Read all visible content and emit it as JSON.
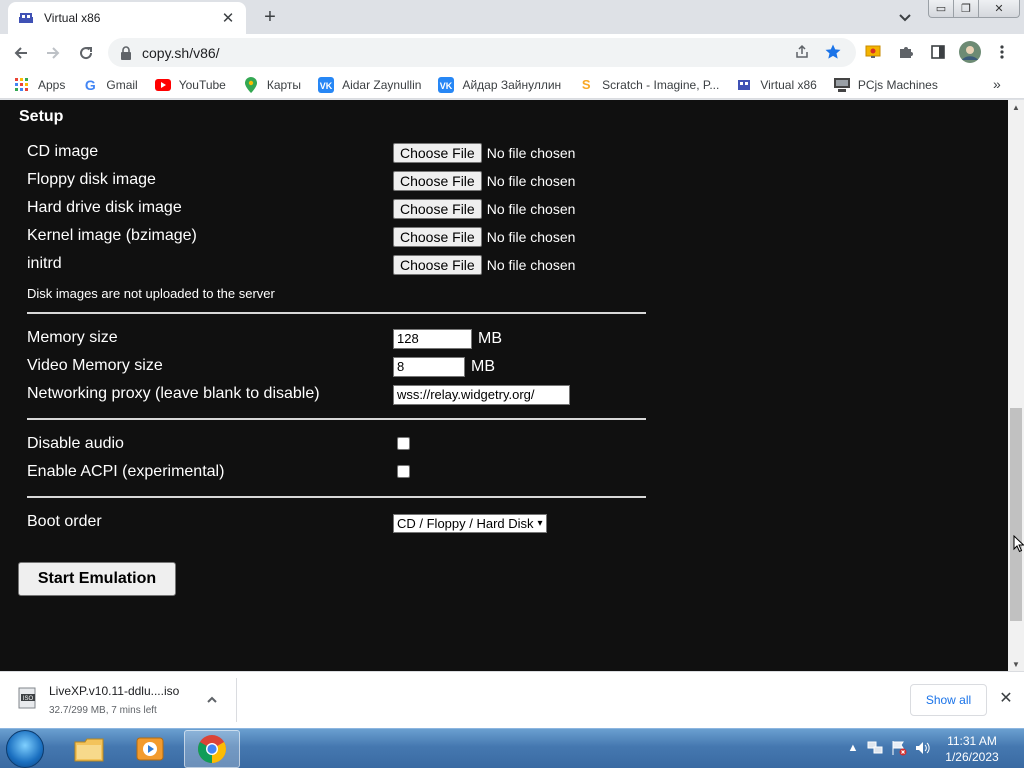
{
  "browser": {
    "tab": {
      "title": "Virtual x86",
      "close": "✕"
    },
    "new_tab": "+",
    "window": {
      "minimize": "▭",
      "maximize": "❐",
      "close": "✕"
    },
    "url": "copy.sh/v86/",
    "bookmarks": [
      {
        "label": "Apps",
        "icon": "apps-grid-icon"
      },
      {
        "label": "Gmail",
        "icon": "google-icon"
      },
      {
        "label": "YouTube",
        "icon": "youtube-icon"
      },
      {
        "label": "Карты",
        "icon": "maps-pin-icon"
      },
      {
        "label": "Aidar Zaynullin",
        "icon": "vk-icon"
      },
      {
        "label": "Айдар Зайнуллин",
        "icon": "vk-icon"
      },
      {
        "label": "Scratch - Imagine, P...",
        "icon": "scratch-icon"
      },
      {
        "label": "Virtual x86",
        "icon": "v86-icon"
      },
      {
        "label": "PCjs Machines",
        "icon": "pcjs-icon"
      }
    ],
    "bookmarks_more": "»"
  },
  "setup": {
    "heading": "Setup",
    "files": [
      {
        "label": "CD image",
        "button": "Choose File",
        "status": "No file chosen"
      },
      {
        "label": "Floppy disk image",
        "button": "Choose File",
        "status": "No file chosen"
      },
      {
        "label": "Hard drive disk image",
        "button": "Choose File",
        "status": "No file chosen"
      },
      {
        "label": "Kernel image (bzimage)",
        "button": "Choose File",
        "status": "No file chosen"
      },
      {
        "label": "initrd",
        "button": "Choose File",
        "status": "No file chosen"
      }
    ],
    "note": "Disk images are not uploaded to the server",
    "memory": {
      "label": "Memory size",
      "value": "128",
      "unit": "MB"
    },
    "video_memory": {
      "label": "Video Memory size",
      "value": "8",
      "unit": "MB"
    },
    "proxy": {
      "label": "Networking proxy (leave blank to disable)",
      "value": "wss://relay.widgetry.org/"
    },
    "disable_audio": {
      "label": "Disable audio",
      "checked": false
    },
    "enable_acpi": {
      "label": "Enable ACPI (experimental)",
      "checked": false
    },
    "boot_order": {
      "label": "Boot order",
      "selected": "CD / Floppy / Hard Disk"
    },
    "start_button": "Start Emulation"
  },
  "downloads": {
    "file_name": "LiveXP.v10.11-ddlu....iso",
    "status": "32.7/299 MB, 7 mins left",
    "show_all": "Show all"
  },
  "taskbar": {
    "time": "11:31 AM",
    "date": "1/26/2023"
  },
  "colors": {
    "page_bg": "#101010",
    "accent_blue": "#1a73e8",
    "star_blue": "#1a73e8"
  }
}
